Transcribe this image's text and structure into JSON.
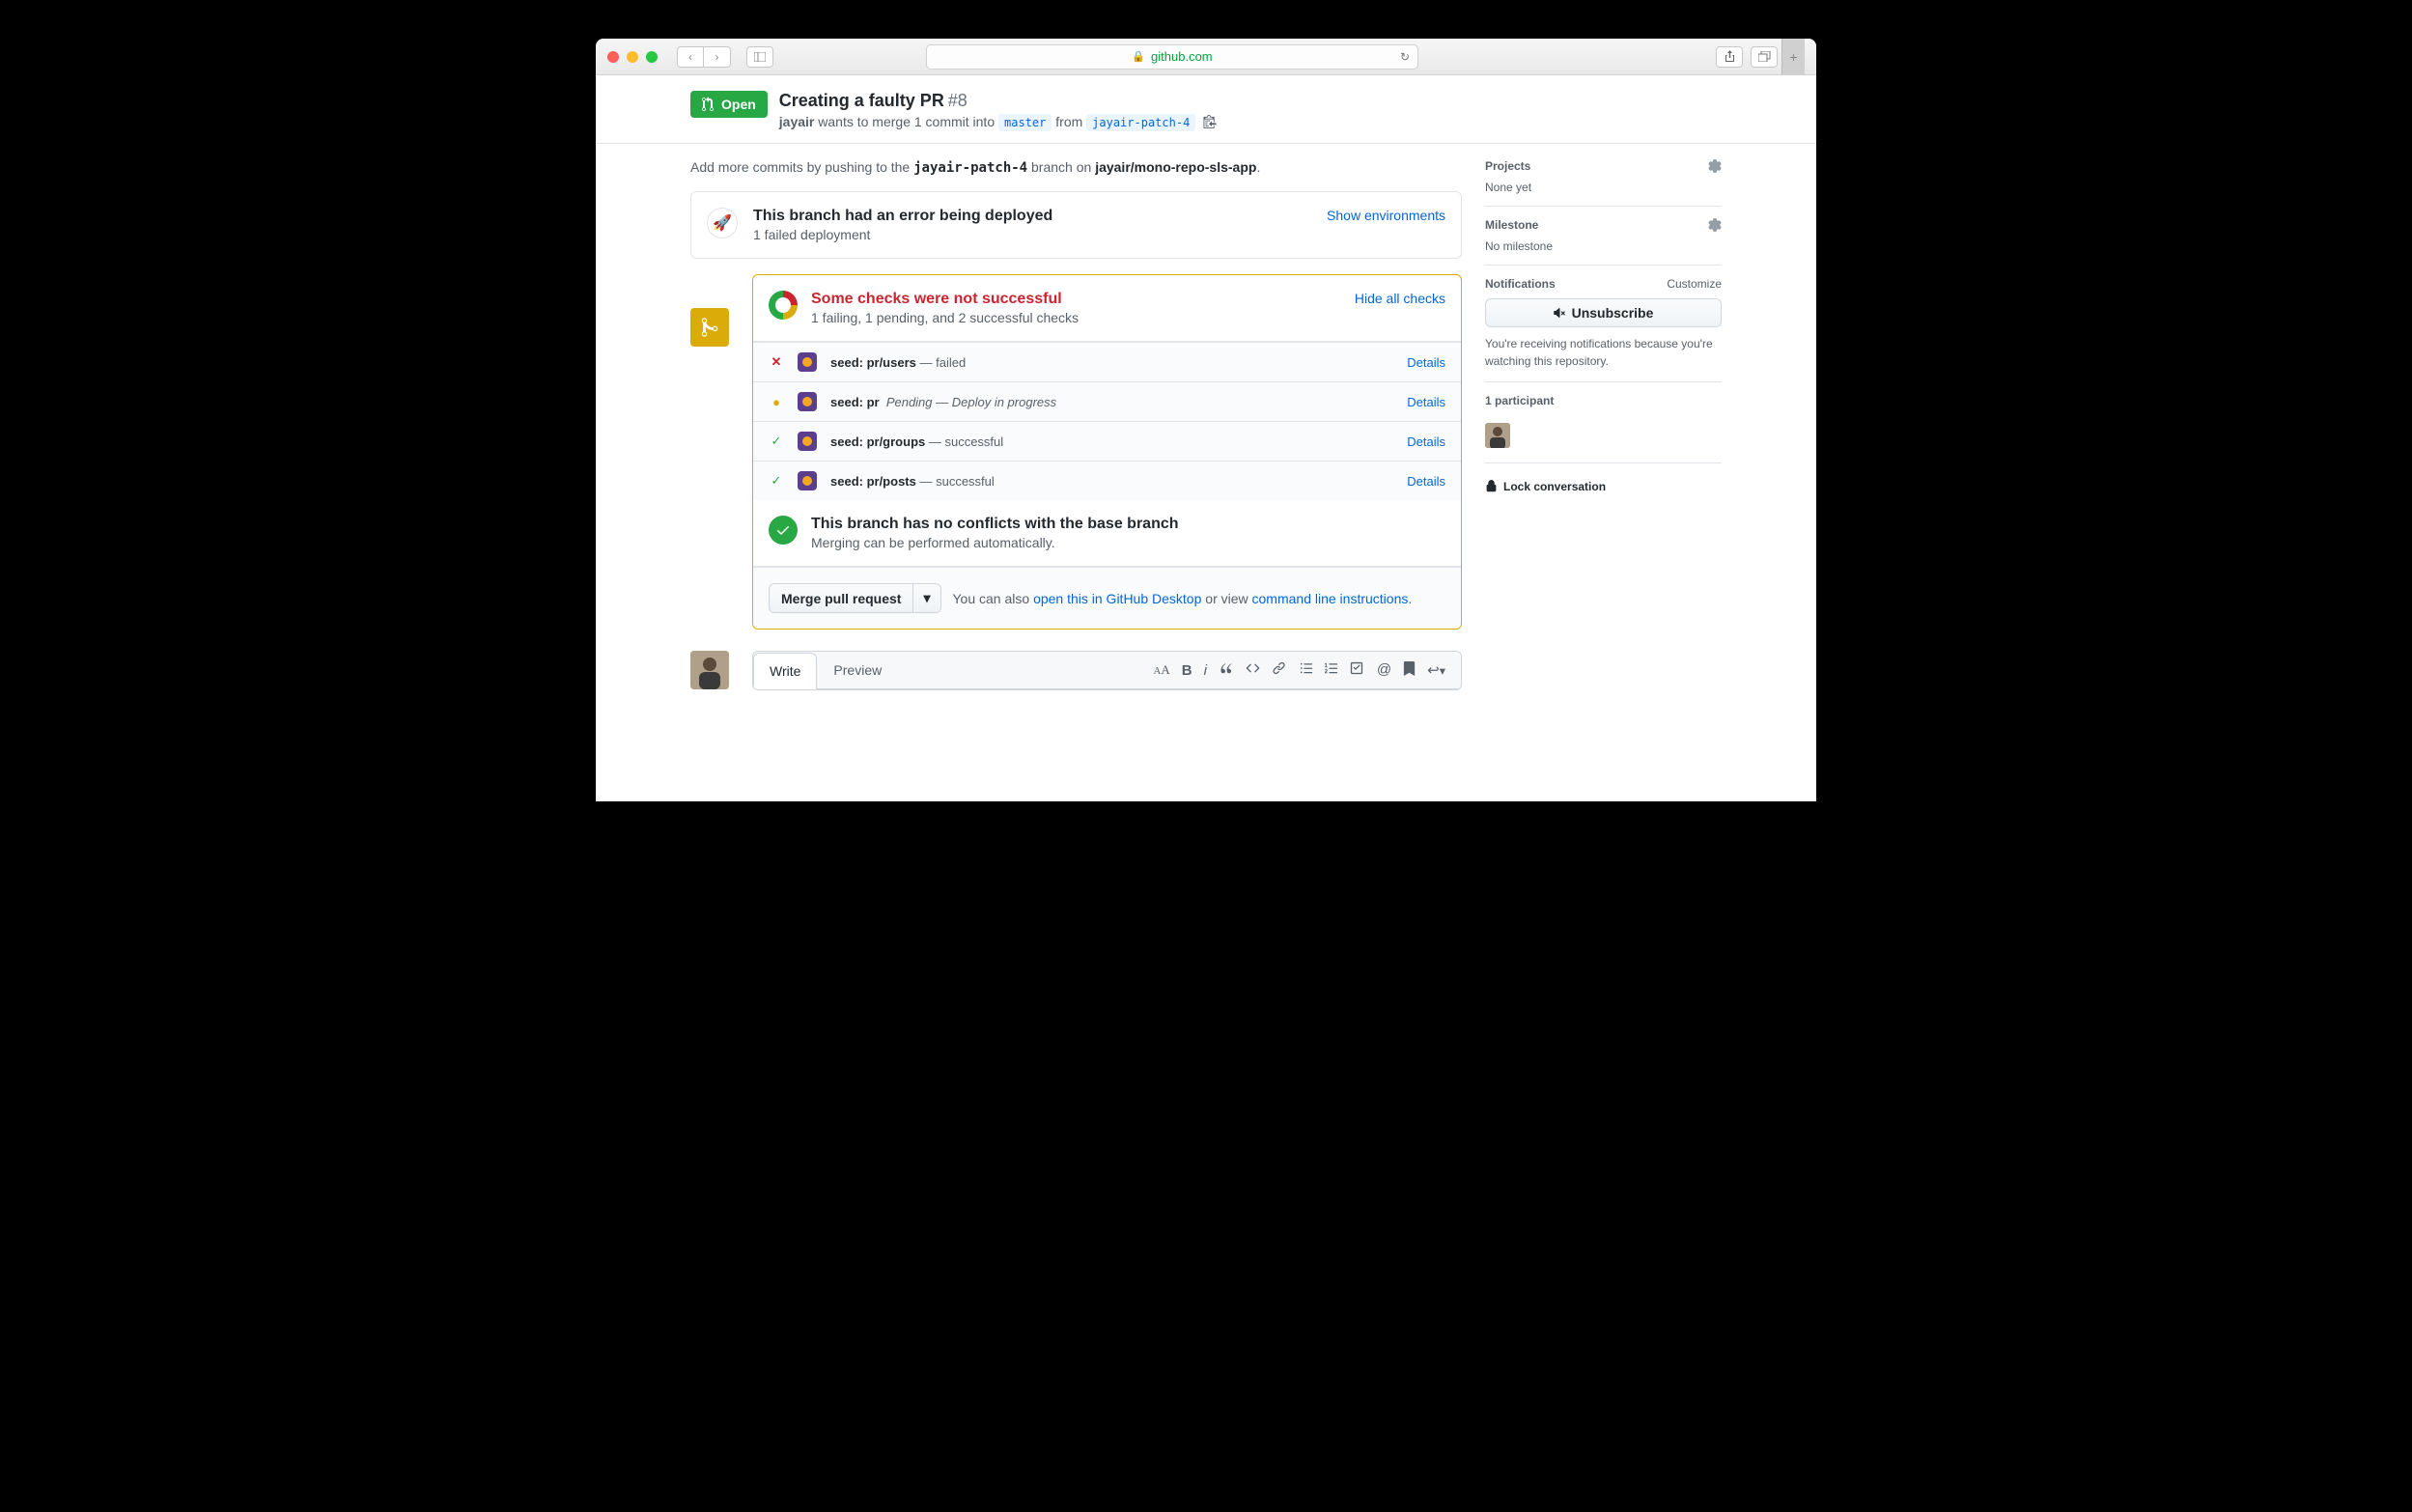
{
  "browser": {
    "host": "github.com"
  },
  "pr": {
    "state": "Open",
    "title": "Creating a faulty PR",
    "number": "#8",
    "author": "jayair",
    "meta_mid": " wants to merge 1 commit into ",
    "base": "master",
    "meta_from": " from ",
    "head": "jayair-patch-4"
  },
  "hint": {
    "prefix": "Add more commits by pushing to the ",
    "branch": "jayair-patch-4",
    "mid": " branch on ",
    "repo": "jayair/mono-repo-sls-app",
    "suffix": "."
  },
  "deploy": {
    "icon": "🚀",
    "title": "This branch had an error being deployed",
    "sub": "1 failed deployment",
    "link": "Show environments"
  },
  "checks": {
    "title": "Some checks were not successful",
    "sub": "1 failing, 1 pending, and 2 successful checks",
    "hide": "Hide all checks",
    "items": [
      {
        "status": "fail",
        "name": "seed: pr/users",
        "desc": " — failed",
        "details": "Details"
      },
      {
        "status": "pending",
        "name": "seed: pr",
        "desc": "Pending — Deploy in progress",
        "details": "Details"
      },
      {
        "status": "pass",
        "name": "seed: pr/groups",
        "desc": " — successful",
        "details": "Details"
      },
      {
        "status": "pass",
        "name": "seed: pr/posts",
        "desc": " — successful",
        "details": "Details"
      }
    ]
  },
  "conflicts": {
    "title": "This branch has no conflicts with the base branch",
    "sub": "Merging can be performed automatically."
  },
  "merge": {
    "button": "Merge pull request",
    "instr_pre": "You can also ",
    "desktop": "open this in GitHub Desktop",
    "instr_mid": " or view ",
    "cli": "command line instructions",
    "instr_post": "."
  },
  "comment": {
    "write": "Write",
    "preview": "Preview"
  },
  "sidebar": {
    "projects": {
      "title": "Projects",
      "value": "None yet"
    },
    "milestone": {
      "title": "Milestone",
      "value": "No milestone"
    },
    "notifications": {
      "title": "Notifications",
      "customize": "Customize",
      "button": "Unsubscribe",
      "note": "You're receiving notifications because you're watching this repository."
    },
    "participants": {
      "title": "1 participant"
    },
    "lock": "Lock conversation"
  }
}
